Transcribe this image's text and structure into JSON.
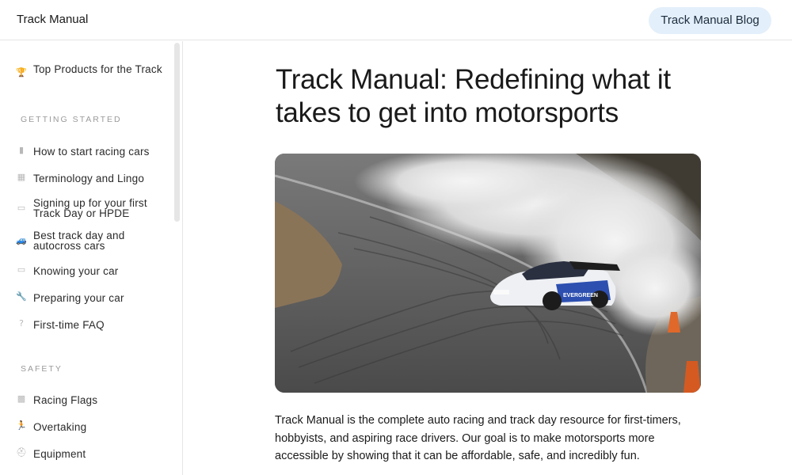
{
  "header": {
    "brand": "Track Manual",
    "blog_button": "Track Manual Blog"
  },
  "sidebar": {
    "top_item": {
      "icon": "trophy-icon",
      "label": "Top Products for the Track"
    },
    "sections": [
      {
        "heading": "GETTING STARTED",
        "items": [
          {
            "icon": "fire-extinguisher-icon",
            "label": "How to start racing cars"
          },
          {
            "icon": "calendar-icon",
            "label": "Terminology and Lingo"
          },
          {
            "icon": "ticket-icon",
            "label": "Signing up for your first Track Day or HPDE"
          },
          {
            "icon": "car-icon",
            "label": "Best track day and autocross cars"
          },
          {
            "icon": "card-icon",
            "label": "Knowing your car"
          },
          {
            "icon": "wrench-icon",
            "label": "Preparing your car"
          },
          {
            "icon": "question-icon",
            "label": "First-time FAQ"
          }
        ]
      },
      {
        "heading": "SAFETY",
        "items": [
          {
            "icon": "checkered-flag-icon",
            "label": "Racing Flags"
          },
          {
            "icon": "runner-icon",
            "label": "Overtaking"
          },
          {
            "icon": "helmet-icon",
            "label": "Equipment"
          }
        ]
      }
    ]
  },
  "main": {
    "title": "Track Manual: Redefining what it takes to get into motorsports",
    "hero_image": "drifting-race-car-photo",
    "car_livery_text": "EVERGREEN",
    "intro": "Track Manual is the complete auto racing and track day resource for first-timers, hobbyists, and aspiring race drivers. Our goal is to make motorsports more accessible by showing that it can be affordable, safe, and incredibly fun."
  }
}
